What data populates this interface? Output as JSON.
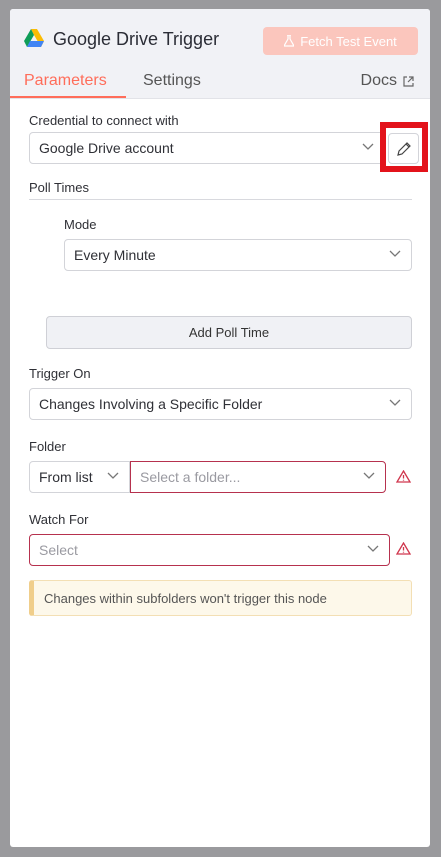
{
  "header": {
    "title": "Google Drive Trigger",
    "fetch_button": "Fetch Test Event",
    "tabs": [
      {
        "label": "Parameters",
        "active": true
      },
      {
        "label": "Settings",
        "active": false
      }
    ],
    "docs_label": "Docs"
  },
  "credential": {
    "label": "Credential to connect with",
    "value": "Google Drive account"
  },
  "poll_times": {
    "label": "Poll Times",
    "mode_label": "Mode",
    "mode_value": "Every Minute",
    "add_button": "Add Poll Time"
  },
  "trigger_on": {
    "label": "Trigger On",
    "value": "Changes Involving a Specific Folder"
  },
  "folder": {
    "label": "Folder",
    "source_value": "From list",
    "placeholder": "Select a folder..."
  },
  "watch_for": {
    "label": "Watch For",
    "placeholder": "Select"
  },
  "notice": "Changes within subfolders won't trigger this node",
  "colors": {
    "accent": "#ff6d5a",
    "error": "#b6314e",
    "highlight": "#e3131b"
  },
  "icons": [
    "google-drive-icon",
    "flask-icon",
    "external-link-icon",
    "pencil-icon",
    "chevron-down-icon",
    "warning-icon"
  ]
}
